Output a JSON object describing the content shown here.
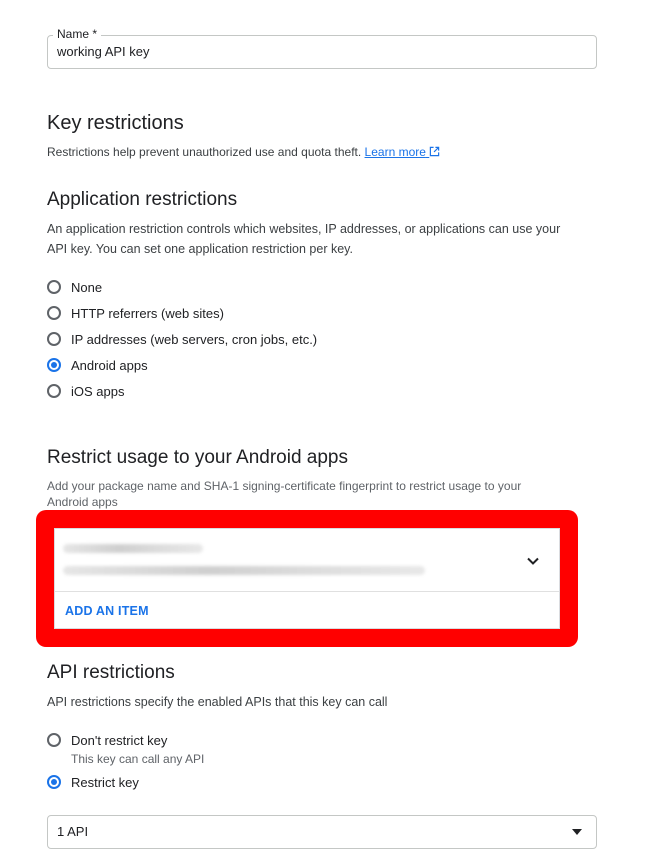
{
  "name_field": {
    "label": "Name *",
    "value": "working API key"
  },
  "key_restrictions": {
    "title": "Key restrictions",
    "description": "Restrictions help prevent unauthorized use and quota theft.",
    "learn_more": "Learn more"
  },
  "application_restrictions": {
    "title": "Application restrictions",
    "description_line1": "An application restriction controls which websites, IP addresses, or applications can use your",
    "description_line2": "API key. You can set one application restriction per key.",
    "options": [
      {
        "label": "None",
        "selected": false
      },
      {
        "label": "HTTP referrers (web sites)",
        "selected": false
      },
      {
        "label": "IP addresses (web servers, cron jobs, etc.)",
        "selected": false
      },
      {
        "label": "Android apps",
        "selected": true
      },
      {
        "label": "iOS apps",
        "selected": false
      }
    ]
  },
  "android_restrict": {
    "title": "Restrict usage to your Android apps",
    "description_line1": "Add your package name and SHA-1 signing-certificate fingerprint to restrict usage to your",
    "description_line2": "Android apps",
    "add_item": "ADD AN ITEM",
    "highlight_color": "#ff0000"
  },
  "api_restrictions": {
    "title": "API restrictions",
    "description": "API restrictions specify the enabled APIs that this key can call",
    "options": [
      {
        "label": "Don't restrict key",
        "sublabel": "This key can call any API",
        "selected": false
      },
      {
        "label": "Restrict key",
        "selected": true
      }
    ],
    "select_value": "1 API"
  },
  "colors": {
    "accent": "#1a73e8",
    "text": "#202124"
  }
}
